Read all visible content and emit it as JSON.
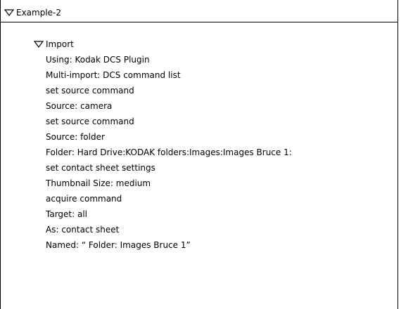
{
  "action_set": {
    "name": "Example-2",
    "expanded": true,
    "action": {
      "name": "Import",
      "expanded": true,
      "steps": [
        "Using: Kodak DCS Plugin",
        "Multi-import: DCS command list",
        "set source command",
        "Source: camera",
        "set source command",
        "Source: folder",
        "Folder: Hard Drive:KODAK folders:Images:Images Bruce 1:",
        "set contact sheet settings",
        "Thumbnail Size: medium",
        "acquire command",
        "Target: all",
        "As: contact sheet",
        "Named: “ Folder: Images Bruce 1”"
      ]
    }
  },
  "icons": {
    "disclosure_open": "triangle-down-outline"
  },
  "colors": {
    "background": "#ffffff",
    "border": "#000000",
    "text": "#000000"
  }
}
